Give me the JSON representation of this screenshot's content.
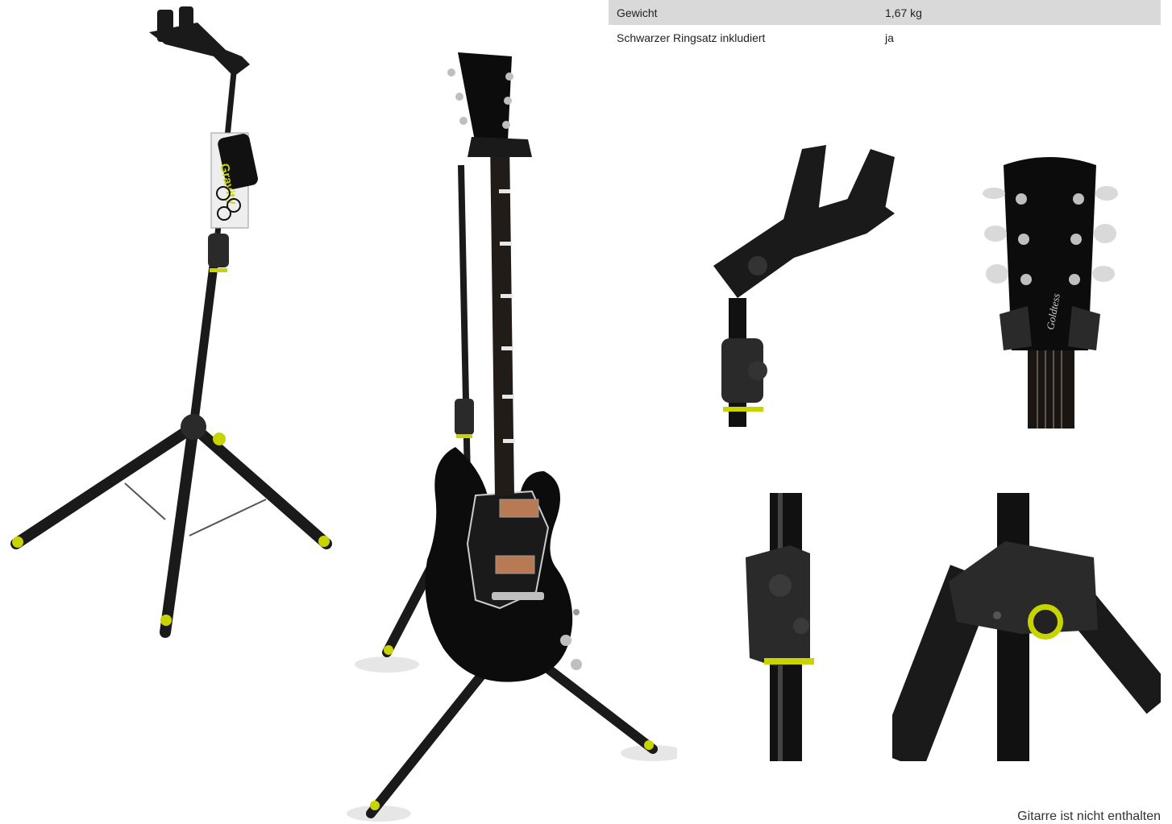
{
  "specs": [
    {
      "label": "Gewicht",
      "value": "1,67 kg"
    },
    {
      "label": "Schwarzer Ringsatz inkludiert",
      "value": "ja"
    }
  ],
  "brand": {
    "tag_text": "Gravity",
    "accent": "#c8d400"
  },
  "guitar": {
    "headstock_logo": "Goldtess"
  },
  "caption": "Gitarre ist nicht enthalten",
  "colors": {
    "stand": "#1a1a1a",
    "ring": "#c8d400",
    "chrome": "#bfbfbf",
    "pickup": "#b87a55"
  }
}
